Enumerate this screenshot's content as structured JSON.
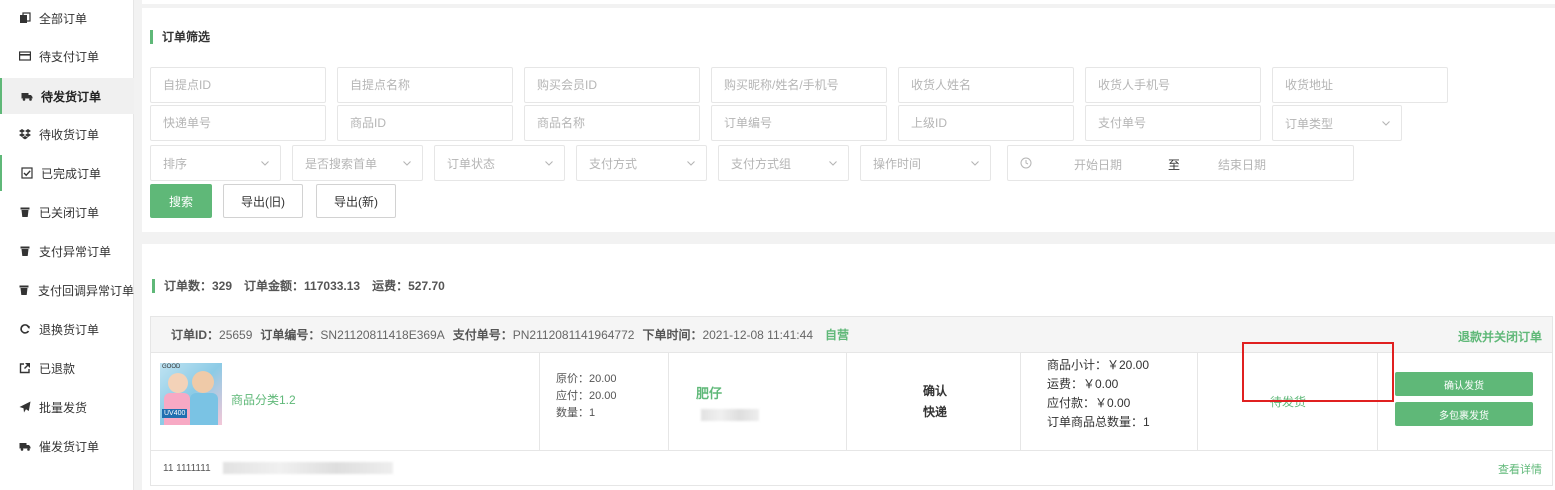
{
  "sidebar": {
    "items": [
      {
        "label": "全部订单",
        "icon": "copy-icon"
      },
      {
        "label": "待支付订单",
        "icon": "credit-card-icon"
      },
      {
        "label": "待发货订单",
        "icon": "truck-icon",
        "active": true
      },
      {
        "label": "待收货订单",
        "icon": "dropbox-icon"
      },
      {
        "label": "已完成订单",
        "icon": "check-square-icon"
      },
      {
        "label": "已关闭订单",
        "icon": "trash-icon"
      },
      {
        "label": "支付异常订单",
        "icon": "trash-icon"
      },
      {
        "label": "支付回调异常订单",
        "icon": "trash-icon"
      },
      {
        "label": "退换货订单",
        "icon": "refresh-icon"
      },
      {
        "label": "已退款",
        "icon": "external-link-icon"
      },
      {
        "label": "批量发货",
        "icon": "paper-plane-icon"
      },
      {
        "label": "催发货订单",
        "icon": "truck-icon"
      }
    ]
  },
  "filter": {
    "title": "订单筛选",
    "row1": [
      "自提点ID",
      "自提点名称",
      "购买会员ID",
      "购买昵称/姓名/手机号",
      "收货人姓名",
      "收货人手机号",
      "收货地址"
    ],
    "row2": [
      "快递单号",
      "商品ID",
      "商品名称",
      "订单编号",
      "上级ID",
      "支付单号"
    ],
    "row2_select": "订单类型",
    "row3_selects": [
      "排序",
      "是否搜索首单",
      "订单状态",
      "支付方式",
      "支付方式组",
      "操作时间"
    ],
    "date": {
      "start": "开始日期",
      "sep": "至",
      "end": "结束日期"
    },
    "buttons": {
      "search": "搜索",
      "export_old": "导出(旧)",
      "export_new": "导出(新)"
    }
  },
  "summary": {
    "count": "订单数：329",
    "amount": "订单金额：117033.13",
    "freight": "运费：527.70"
  },
  "order": {
    "id_label": "订单ID：",
    "id": "25659",
    "no_label": "订单编号：",
    "no": "SN21120811418E369A",
    "pay_label": "支付单号：",
    "pay_no": "PN2112081141964772",
    "time_label": "下单时间：",
    "time": "2021-12-08 11:41:44",
    "tag": "自营",
    "close_link": "退款并关闭订单",
    "product": {
      "name": "商品分类1.2",
      "brand": "GOOD",
      "badge": "UV400"
    },
    "prices": {
      "original": "原价：20.00",
      "payable": "应付：20.00",
      "quantity": "数量：1"
    },
    "buyer": "肥仔",
    "ship": {
      "line1": "确认",
      "line2": "快递"
    },
    "sums": {
      "subtotal": "商品小计：￥20.00",
      "freight": "运费：￥0.00",
      "payable": "应付款：￥0.00",
      "total_qty": "订单商品总数量：1"
    },
    "status": "待发货",
    "actions": {
      "confirm": "确认发货",
      "multi": "多包裹发货"
    },
    "address_prefix": "11  1111111",
    "detail_link": "查看详情"
  },
  "colors": {
    "accent": "#5fb878",
    "highlight": "#e02020"
  }
}
